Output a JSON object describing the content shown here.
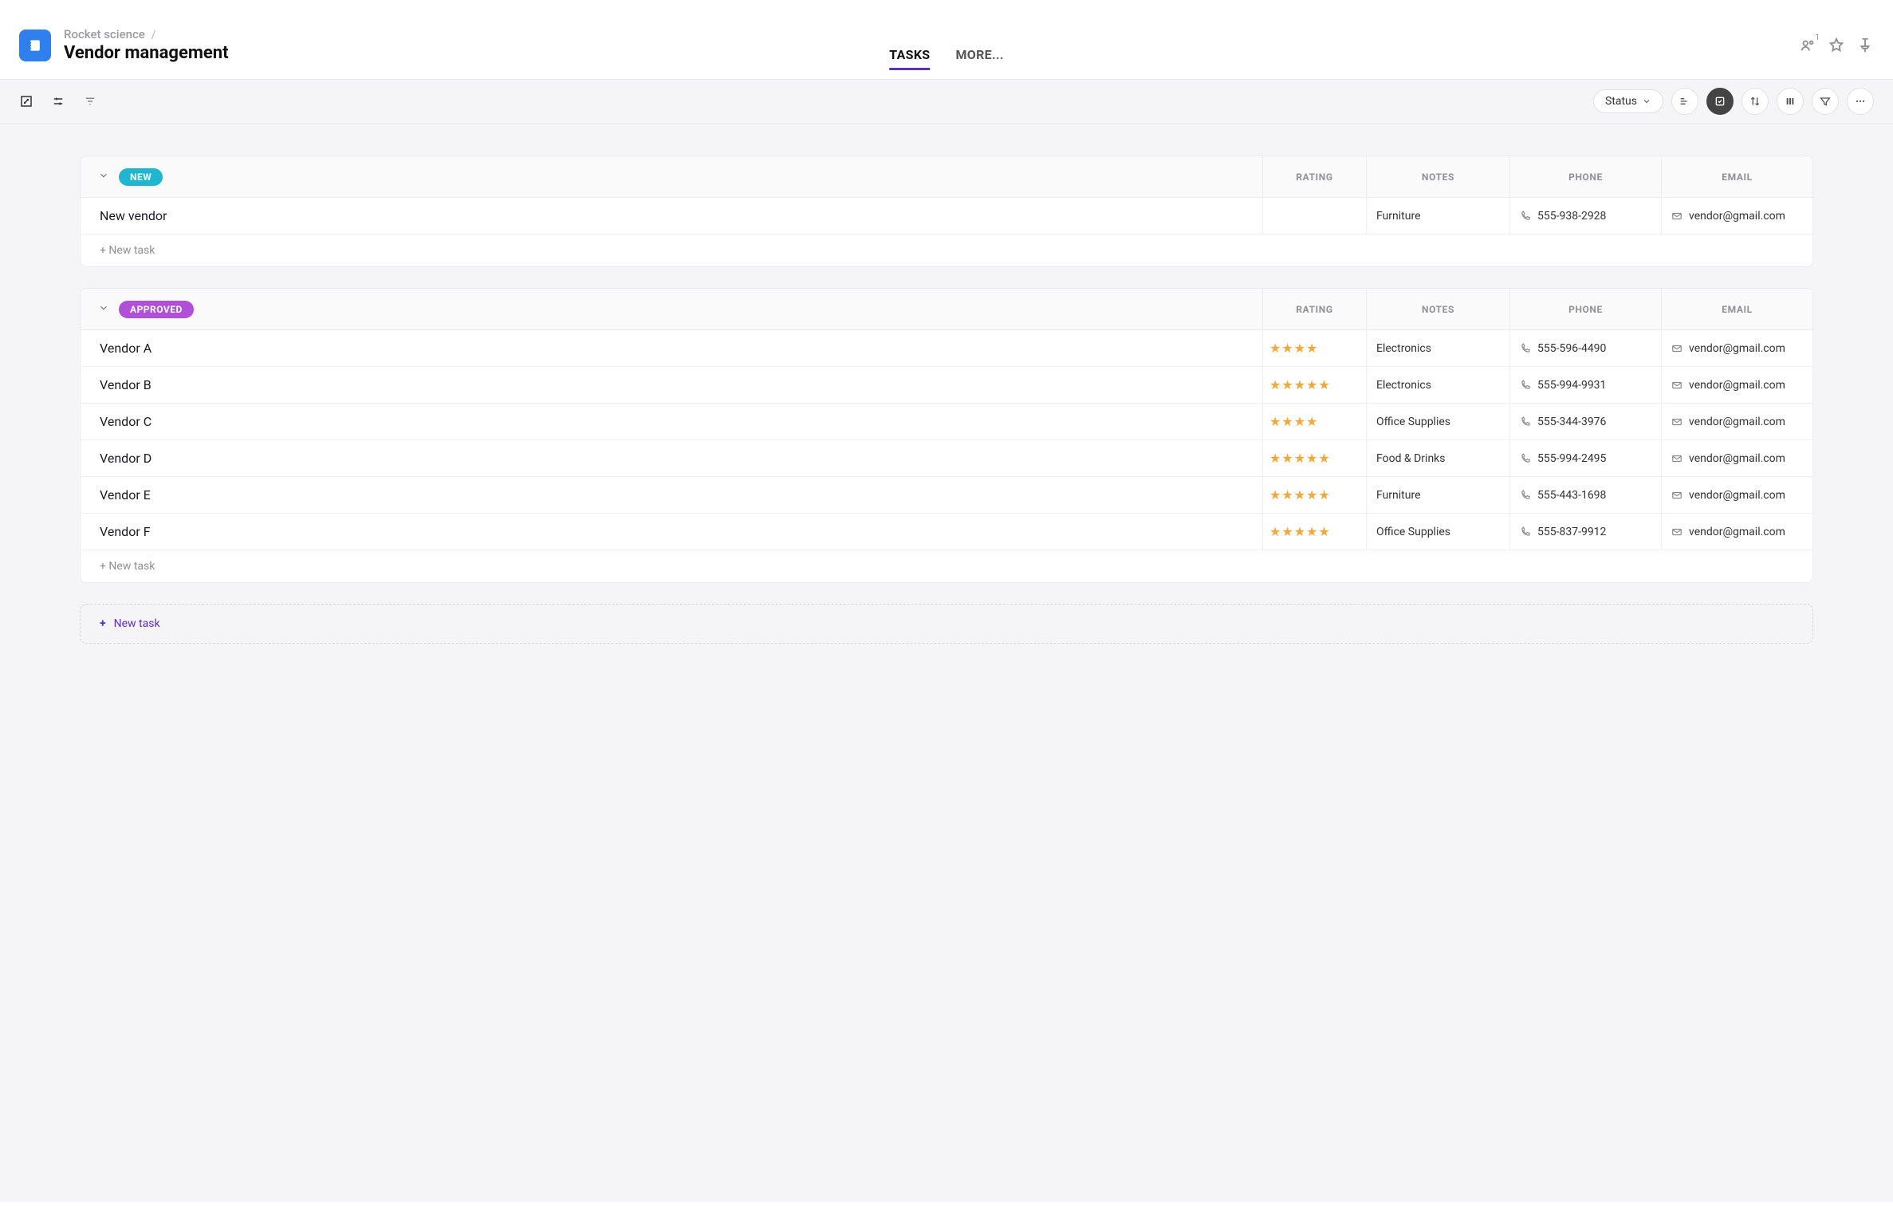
{
  "header": {
    "breadcrumb_parent": "Rocket science",
    "breadcrumb_slash": "/",
    "title": "Vendor management",
    "share_badge": "1"
  },
  "tabs": {
    "tasks": "TASKS",
    "more": "MORE..."
  },
  "toolbar": {
    "status_label": "Status"
  },
  "columns": {
    "rating": "RATING",
    "notes": "NOTES",
    "phone": "PHONE",
    "email": "EMAIL"
  },
  "groups": [
    {
      "status_key": "new",
      "status_label": "NEW",
      "rows": [
        {
          "name": "New vendor",
          "rating": 0,
          "notes": "Furniture",
          "phone": "555-938-2928",
          "email": "vendor@gmail.com"
        }
      ]
    },
    {
      "status_key": "approved",
      "status_label": "APPROVED",
      "rows": [
        {
          "name": "Vendor A",
          "rating": 4,
          "notes": "Electronics",
          "phone": "555-596-4490",
          "email": "vendor@gmail.com"
        },
        {
          "name": "Vendor B",
          "rating": 5,
          "notes": "Electronics",
          "phone": "555-994-9931",
          "email": "vendor@gmail.com"
        },
        {
          "name": "Vendor C",
          "rating": 4,
          "notes": "Office Supplies",
          "phone": "555-344-3976",
          "email": "vendor@gmail.com"
        },
        {
          "name": "Vendor D",
          "rating": 5,
          "notes": "Food & Drinks",
          "phone": "555-994-2495",
          "email": "vendor@gmail.com"
        },
        {
          "name": "Vendor E",
          "rating": 5,
          "notes": "Furniture",
          "phone": "555-443-1698",
          "email": "vendor@gmail.com"
        },
        {
          "name": "Vendor F",
          "rating": 5,
          "notes": "Office Supplies",
          "phone": "555-837-9912",
          "email": "vendor@gmail.com"
        }
      ]
    }
  ],
  "actions": {
    "new_task": "+ New task",
    "bottom_plus": "+",
    "bottom_label": "New task"
  }
}
